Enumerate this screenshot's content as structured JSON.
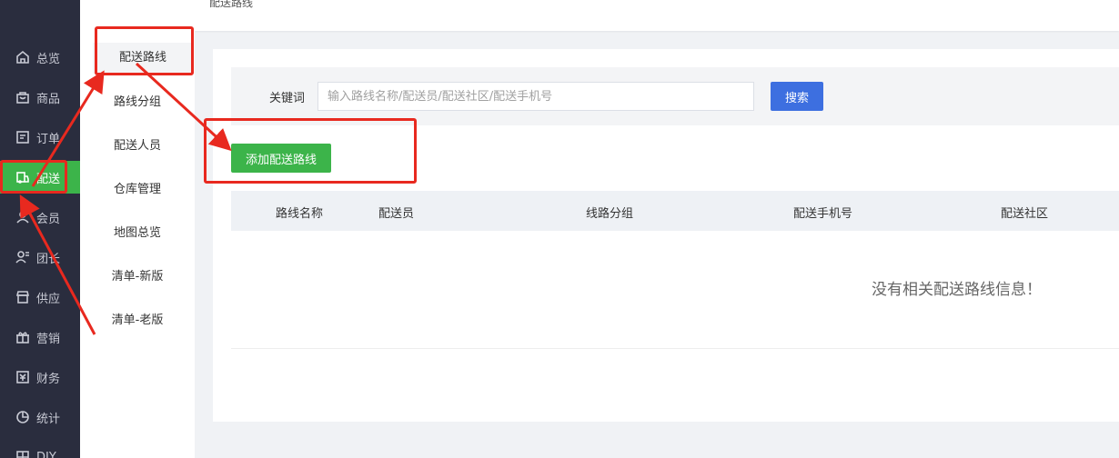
{
  "topbar": {
    "breadcrumb": "配送路线"
  },
  "sidebar": {
    "items": [
      {
        "label": "总览",
        "icon": "home-icon"
      },
      {
        "label": "商品",
        "icon": "bag-icon"
      },
      {
        "label": "订单",
        "icon": "order-icon"
      },
      {
        "label": "配送",
        "icon": "delivery-icon",
        "active": true
      },
      {
        "label": "会员",
        "icon": "user-icon"
      },
      {
        "label": "团长",
        "icon": "leader-icon"
      },
      {
        "label": "供应",
        "icon": "shop-icon"
      },
      {
        "label": "营销",
        "icon": "gift-icon"
      },
      {
        "label": "财务",
        "icon": "finance-icon"
      },
      {
        "label": "统计",
        "icon": "pie-icon"
      },
      {
        "label": "DIY",
        "icon": "diy-icon"
      }
    ]
  },
  "submenu": {
    "items": [
      {
        "label": "配送路线",
        "active": true
      },
      {
        "label": "路线分组"
      },
      {
        "label": "配送人员"
      },
      {
        "label": "仓库管理"
      },
      {
        "label": "地图总览"
      },
      {
        "label": "清单-新版"
      },
      {
        "label": "清单-老版"
      }
    ]
  },
  "search": {
    "label": "关键词",
    "placeholder": "输入路线名称/配送员/配送社区/配送手机号",
    "value": "",
    "button": "搜索"
  },
  "actions": {
    "add_label": "添加配送路线"
  },
  "table": {
    "columns": [
      "路线名称",
      "配送员",
      "线路分组",
      "配送手机号",
      "配送社区"
    ],
    "empty_text": "没有相关配送路线信息！"
  },
  "colors": {
    "accent_green": "#3cb44a",
    "primary_blue": "#3d6fe0",
    "sidebar_bg": "#2a2d3e",
    "annotation_red": "#e8291f"
  }
}
